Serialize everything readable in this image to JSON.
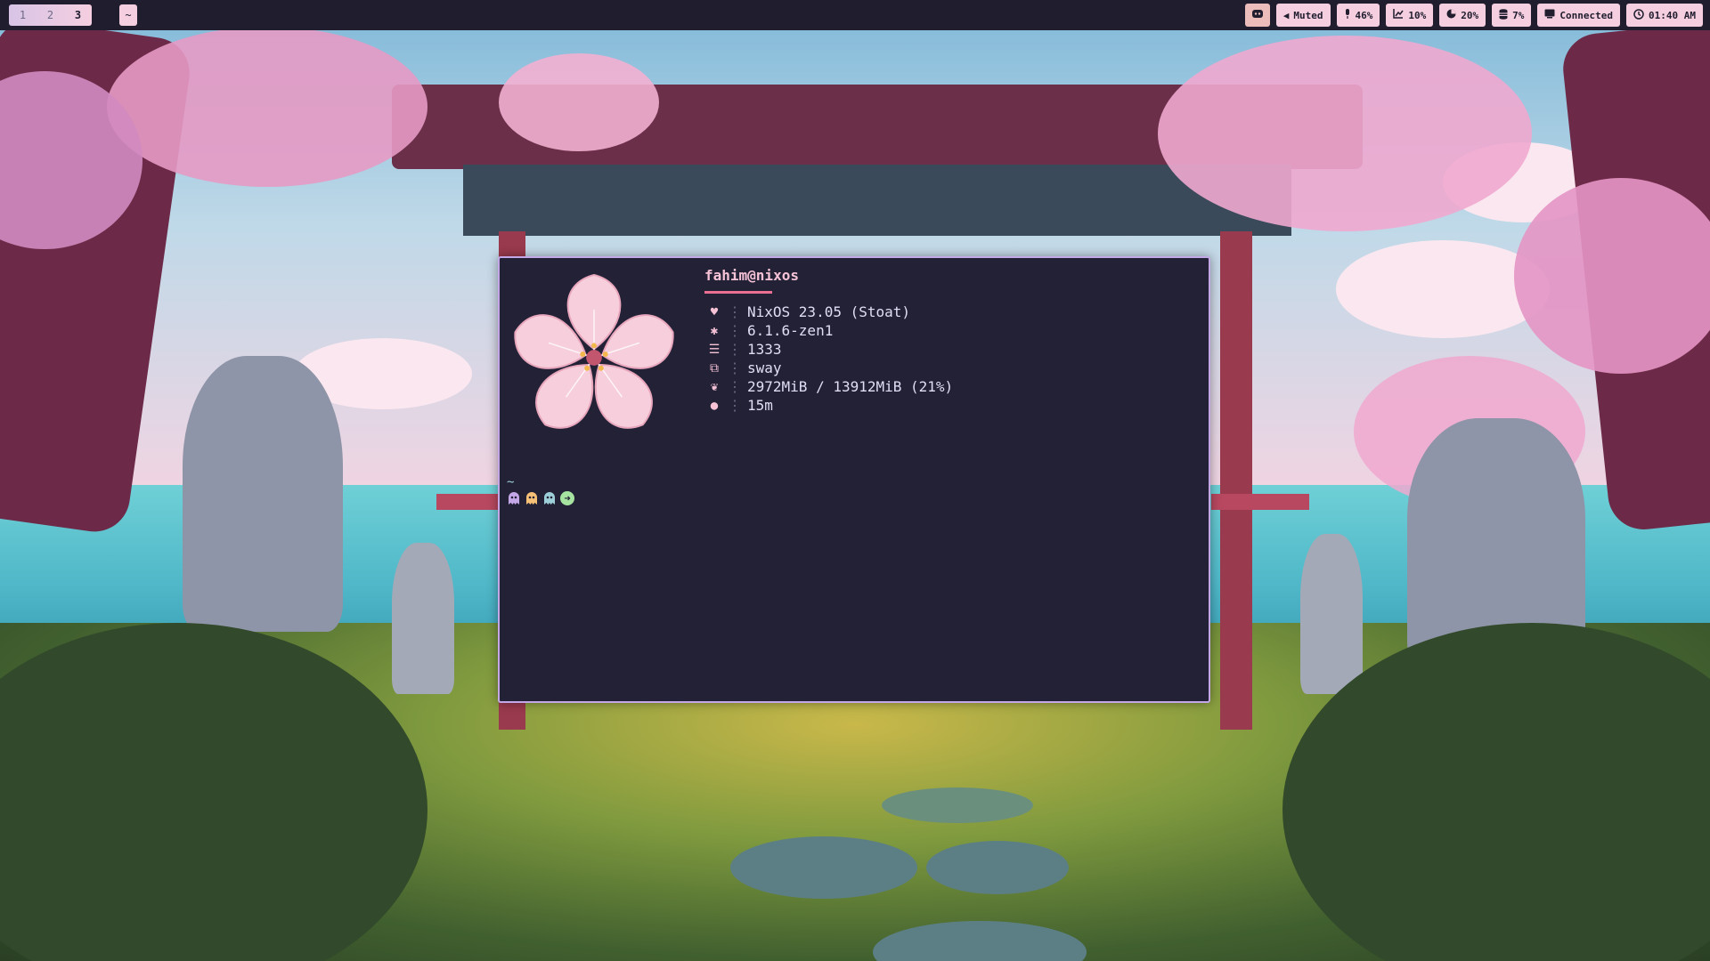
{
  "topbar": {
    "workspaces": [
      {
        "label": "1"
      },
      {
        "label": "2"
      },
      {
        "label": "3",
        "active": true
      }
    ],
    "mode_label": "~",
    "modules": [
      {
        "name": "discord",
        "icon": "discord-icon",
        "text": ""
      },
      {
        "name": "volume",
        "icon": "speaker-icon",
        "text": "Muted"
      },
      {
        "name": "microphone",
        "icon": "mic-icon",
        "text": "46%"
      },
      {
        "name": "cpu",
        "icon": "chart-icon",
        "text": "10%"
      },
      {
        "name": "memory",
        "icon": "pie-icon",
        "text": "20%"
      },
      {
        "name": "disk",
        "icon": "database-icon",
        "text": "7%"
      },
      {
        "name": "network",
        "icon": "network-icon",
        "text": "Connected"
      },
      {
        "name": "clock",
        "icon": "clock-icon",
        "text": "01:40 AM"
      }
    ]
  },
  "terminal": {
    "user_host": "fahim@nixos",
    "info": [
      {
        "icon": "heart-icon",
        "value": "NixOS 23.05 (Stoat)"
      },
      {
        "icon": "gear-icon",
        "value": "6.1.6-zen1"
      },
      {
        "icon": "package-icon",
        "value": "1333"
      },
      {
        "icon": "windows-icon",
        "value": "sway"
      },
      {
        "icon": "leaf-icon",
        "value": "2972MiB / 13912MiB (21%)"
      },
      {
        "icon": "bulb-icon",
        "value": "15m"
      }
    ],
    "prompt_dir": "~"
  },
  "colors": {
    "bar_bg": "#1f1d2e",
    "pill": "#f5cfe0",
    "term_bg": "#232136",
    "term_border": "#c4a7e7",
    "accent_pink": "#eb6f92"
  }
}
